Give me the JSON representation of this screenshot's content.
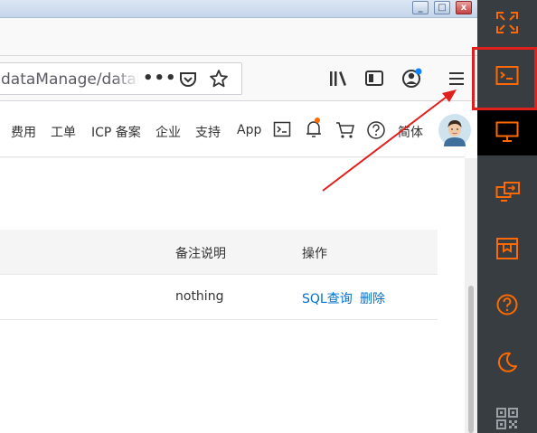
{
  "window": {
    "min_label": "_",
    "max_label": "□",
    "close_label": "x"
  },
  "browser": {
    "url_text": "dataManage/databa",
    "url_more": "•••"
  },
  "console": {
    "nav": [
      "费用",
      "工单",
      "ICP 备案",
      "企业",
      "支持",
      "App"
    ],
    "lang_label": "简体"
  },
  "table": {
    "columns": [
      "备注说明",
      "操作"
    ],
    "rows": [
      {
        "note": "nothing",
        "actions": [
          "SQL查询",
          "删除"
        ]
      }
    ]
  },
  "right_toolbar": {
    "items": [
      "fullscreen-icon",
      "terminal-icon",
      "monitor-icon",
      "screen-transfer-icon",
      "gift-icon",
      "help-icon",
      "moon-icon",
      "qr-code-icon"
    ],
    "accent": "#ff6a00",
    "highlight_color": "#e0201c"
  },
  "colors": {
    "link": "#0070cc",
    "notify_dot": "#ff6a00",
    "toolbar_bg": "#373d41"
  }
}
